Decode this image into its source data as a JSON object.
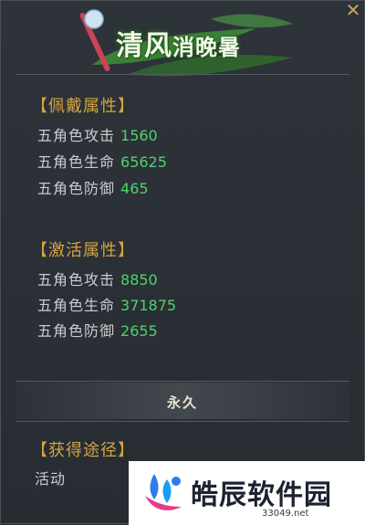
{
  "window": {
    "close_glyph": "✕",
    "title_big": "清风",
    "title_small": "消晚暑"
  },
  "sections": {
    "wear": {
      "title": "【佩戴属性】",
      "stats": [
        {
          "label": "五角色攻击",
          "value": "1560"
        },
        {
          "label": "五角色生命",
          "value": "65625"
        },
        {
          "label": "五角色防御",
          "value": "465"
        }
      ]
    },
    "activate": {
      "title": "【激活属性】",
      "stats": [
        {
          "label": "五角色攻击",
          "value": "8850"
        },
        {
          "label": "五角色生命",
          "value": "371875"
        },
        {
          "label": "五角色防御",
          "value": "2655"
        }
      ]
    },
    "duration": "永久",
    "source": {
      "title": "【获得途径】",
      "value": "活动"
    }
  },
  "watermark": {
    "text": "皓辰软件园",
    "url": "33049.net"
  },
  "colors": {
    "panel_bg": "#2b3037",
    "section_title": "#d2a441",
    "label": "#c9cccf",
    "value_green": "#4ed36a",
    "close_gold": "#c8a35a"
  }
}
